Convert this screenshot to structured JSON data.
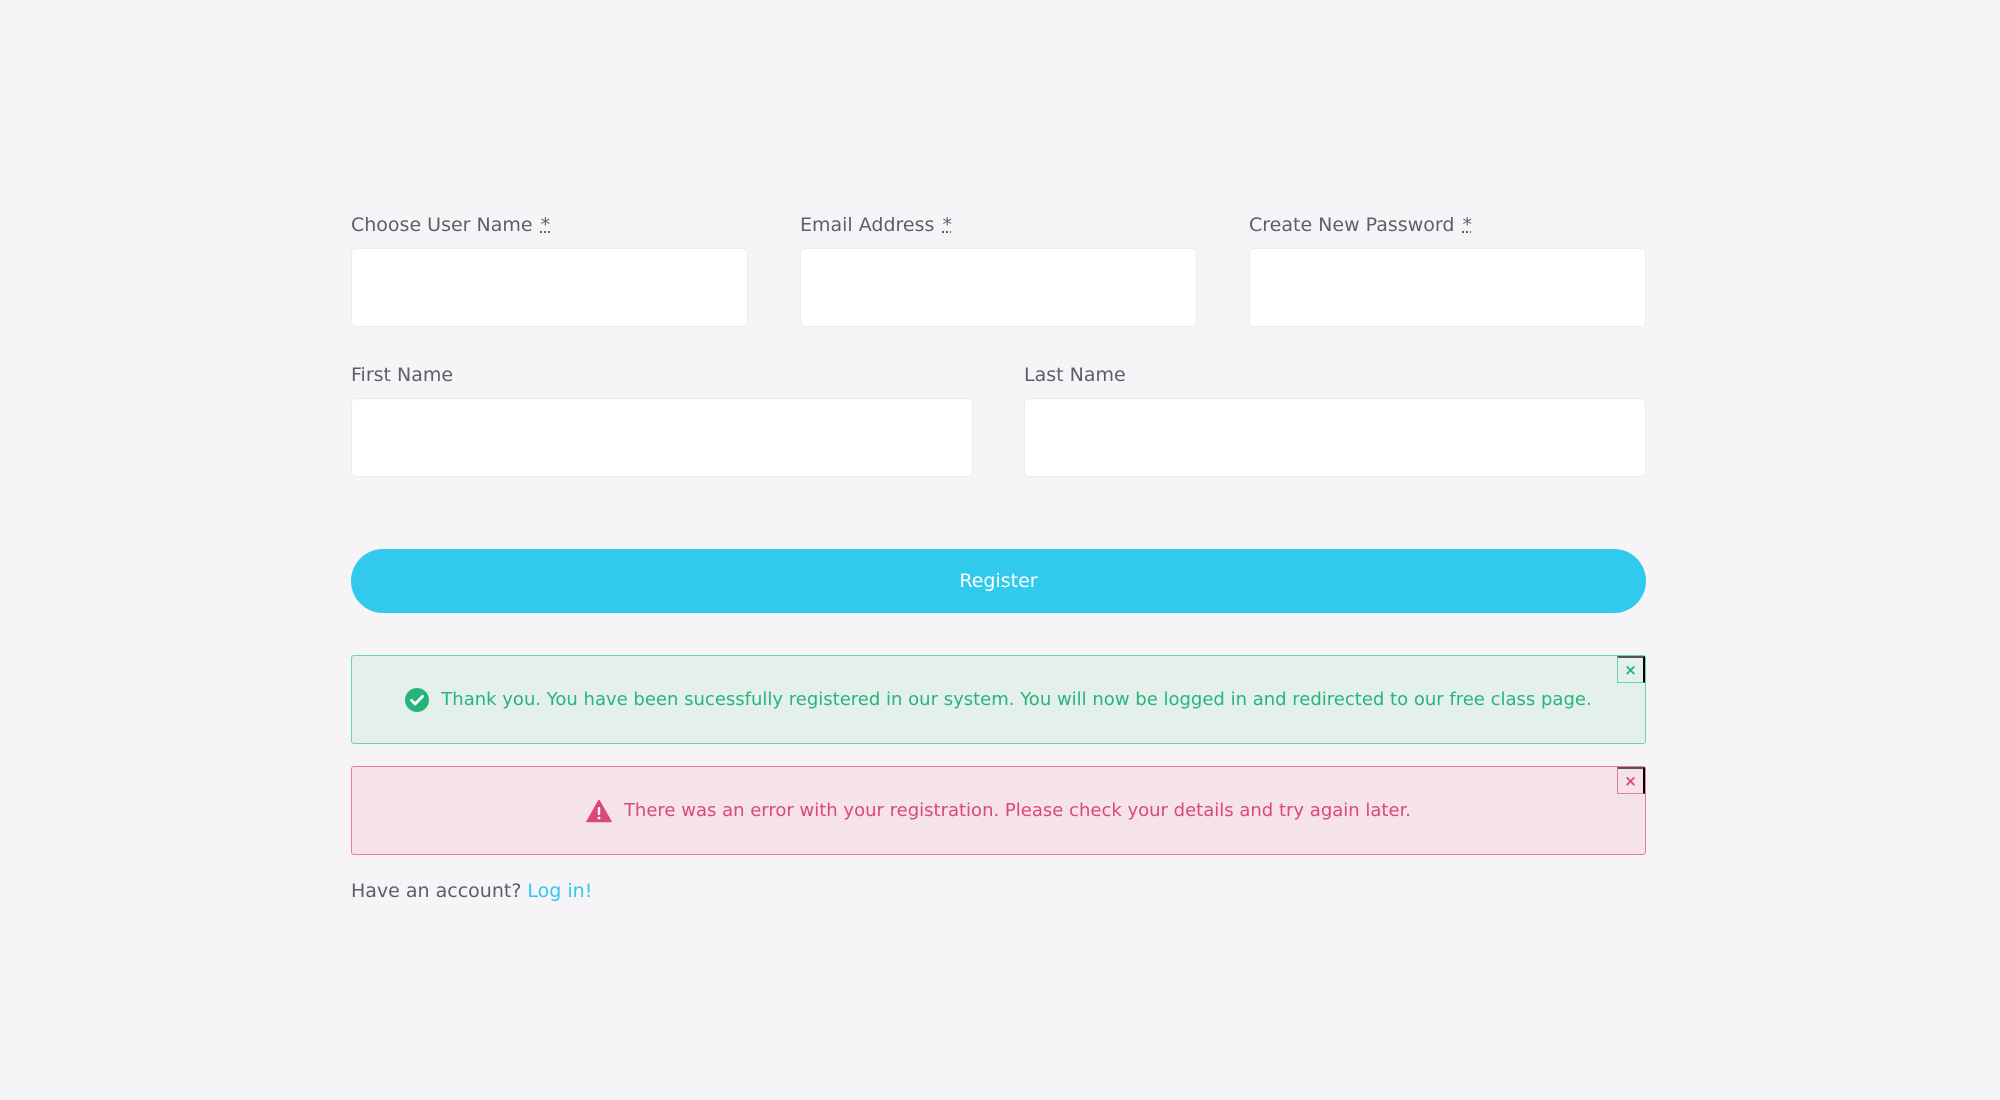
{
  "form": {
    "required_mark": "*",
    "username": {
      "label": "Choose User Name",
      "value": "",
      "placeholder": ""
    },
    "email": {
      "label": "Email Address",
      "value": "",
      "placeholder": ""
    },
    "password": {
      "label": "Create New Password",
      "value": "",
      "placeholder": ""
    },
    "first_name": {
      "label": "First Name",
      "value": "",
      "placeholder": ""
    },
    "last_name": {
      "label": "Last Name",
      "value": "",
      "placeholder": ""
    },
    "register_label": "Register"
  },
  "alerts": {
    "success": {
      "icon": "check-circle-icon",
      "text": "Thank you. You have been sucessfully registered in our system. You will now be logged in and redirected to our free class page.",
      "close_label": "×",
      "color": "#27b47a"
    },
    "error": {
      "icon": "warning-triangle-icon",
      "text": "There was an error with your registration. Please check your details and try again later.",
      "close_label": "×",
      "color": "#dc4876"
    }
  },
  "footer": {
    "prompt": "Have an account?",
    "login_link": "Log in!"
  },
  "colors": {
    "background": "#f6f4f7",
    "accent": "#31c9ec",
    "text": "#5e5e66"
  }
}
